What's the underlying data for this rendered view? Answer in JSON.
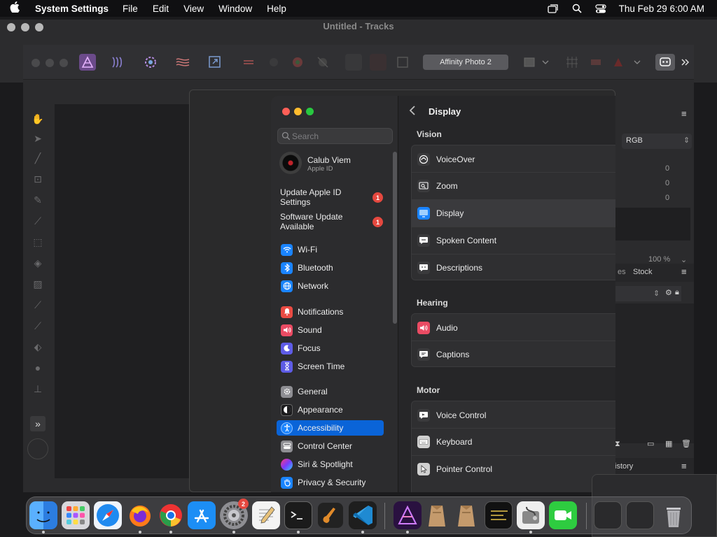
{
  "menubar": {
    "app_name": "System Settings",
    "menus": [
      "File",
      "Edit",
      "View",
      "Window",
      "Help"
    ],
    "clock": "Thu Feb 29  6:00 AM"
  },
  "background_window": {
    "title": "Untitled - Tracks"
  },
  "affinity": {
    "title_button": "Affinity Photo 2",
    "color_mode": "RGB",
    "values": [
      "0",
      "0",
      "0"
    ],
    "zoom": "100 %",
    "tabs": [
      "es",
      "Stock"
    ],
    "history_tab": "istory"
  },
  "settings": {
    "search_placeholder": "Search",
    "profile": {
      "name": "Calub Viem",
      "subtitle": "Apple ID"
    },
    "notices": [
      {
        "label": "Update Apple ID Settings",
        "badge": "1"
      },
      {
        "label": "Software Update Available",
        "badge": "1"
      }
    ],
    "sidebar": [
      {
        "label": "Wi-Fi",
        "icon": "wifi-icon",
        "color": "#1a84ff"
      },
      {
        "label": "Bluetooth",
        "icon": "bluetooth-icon",
        "color": "#1a84ff"
      },
      {
        "label": "Network",
        "icon": "globe-icon",
        "color": "#1a84ff"
      },
      {
        "label": "Notifications",
        "icon": "bell-icon",
        "color": "#ea4b43"
      },
      {
        "label": "Sound",
        "icon": "speaker-icon",
        "color": "#ea4b63"
      },
      {
        "label": "Focus",
        "icon": "moon-icon",
        "color": "#5e5ce6"
      },
      {
        "label": "Screen Time",
        "icon": "hourglass-icon",
        "color": "#5e5ce6"
      },
      {
        "label": "General",
        "icon": "gear-icon",
        "color": "#8e8e93"
      },
      {
        "label": "Appearance",
        "icon": "appearance-icon",
        "color": "#1c1c1e"
      },
      {
        "label": "Accessibility",
        "icon": "accessibility-icon",
        "color": "#1a84ff"
      },
      {
        "label": "Control Center",
        "icon": "control-center-icon",
        "color": "#8e8e93"
      },
      {
        "label": "Siri & Spotlight",
        "icon": "siri-icon",
        "color": "#c03de0"
      },
      {
        "label": "Privacy & Security",
        "icon": "hand-icon",
        "color": "#1a84ff"
      }
    ],
    "page_title": "Display",
    "sections": [
      {
        "title": "Vision",
        "rows": [
          {
            "label": "VoiceOver",
            "icon": "voiceover-icon"
          },
          {
            "label": "Zoom",
            "icon": "zoom-icon"
          },
          {
            "label": "Display",
            "icon": "display-icon"
          },
          {
            "label": "Spoken Content",
            "icon": "speech-bubble-icon"
          },
          {
            "label": "Descriptions",
            "icon": "descriptions-icon"
          }
        ]
      },
      {
        "title": "Hearing",
        "rows": [
          {
            "label": "Audio",
            "icon": "audio-icon"
          },
          {
            "label": "Captions",
            "icon": "captions-icon"
          }
        ]
      },
      {
        "title": "Motor",
        "rows": [
          {
            "label": "Voice Control",
            "icon": "voice-control-icon"
          },
          {
            "label": "Keyboard",
            "icon": "keyboard-icon"
          },
          {
            "label": "Pointer Control",
            "icon": "pointer-icon"
          }
        ]
      }
    ]
  },
  "dock": {
    "settings_badge": "2"
  }
}
